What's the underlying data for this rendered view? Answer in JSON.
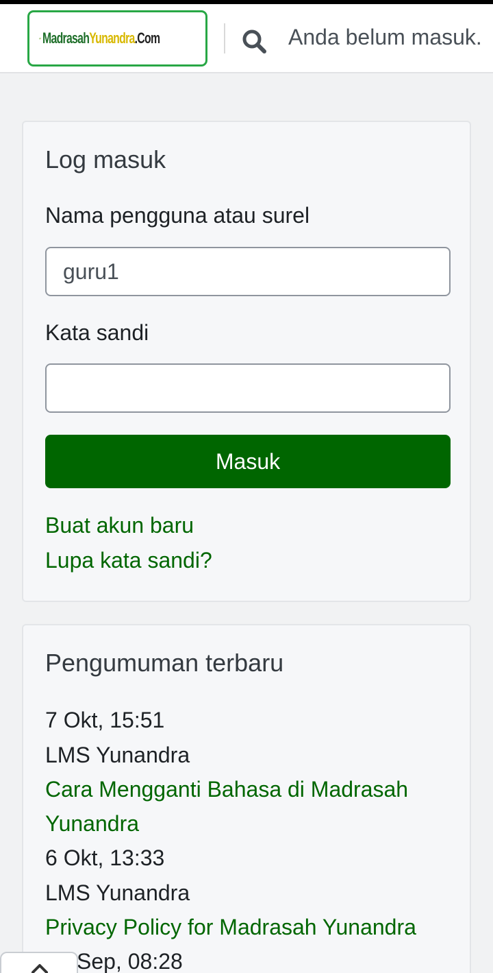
{
  "header": {
    "logo_text": [
      "Madrasah",
      "Yunandra",
      ".Com"
    ],
    "login_status": "Anda belum masuk."
  },
  "login": {
    "title": "Log masuk",
    "username_label": "Nama pengguna atau surel",
    "username_value": "guru1",
    "password_label": "Kata sandi",
    "password_value": "",
    "submit_label": "Masuk",
    "create_account": "Buat akun baru",
    "forgot_password": "Lupa kata sandi?"
  },
  "news": {
    "title": "Pengumuman terbaru",
    "items": [
      {
        "date": "7 Okt, 15:51",
        "author": "LMS Yunandra",
        "title_line1": "Cara Mengganti Bahasa di Madrasah",
        "title_line2": "Yunandra"
      },
      {
        "date": "6 Okt, 13:33",
        "author": "LMS Yunandra",
        "title_line1": "Privacy Policy for Madrasah Yunandra"
      },
      {
        "date": "Sep, 08:28"
      }
    ]
  },
  "icons": {
    "search": "search-icon",
    "back_to_top": "chevron-up-icon"
  },
  "colors": {
    "accent": "#006600",
    "logo_border": "#28a745"
  }
}
